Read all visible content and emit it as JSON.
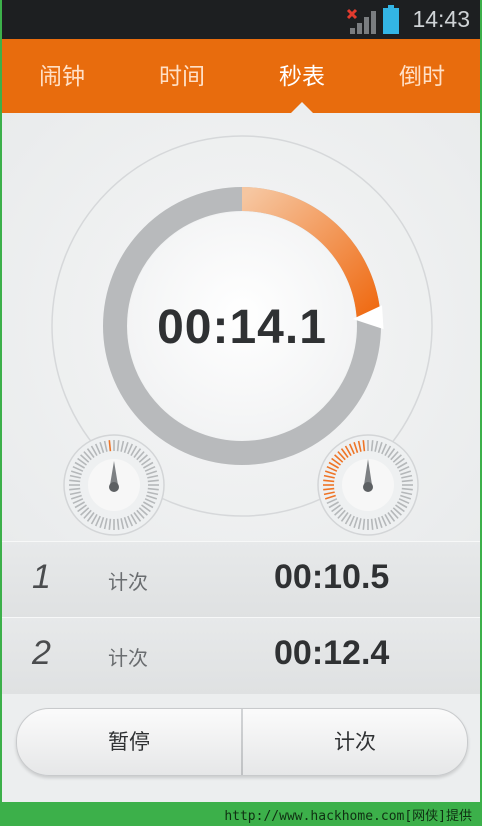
{
  "status_bar": {
    "time": "14:43"
  },
  "tabs": [
    {
      "label": "闹钟"
    },
    {
      "label": "时间"
    },
    {
      "label": "秒表",
      "active": true
    },
    {
      "label": "倒时"
    }
  ],
  "stopwatch": {
    "elapsed": "00:14.1",
    "progress_fraction": 0.24
  },
  "laps": [
    {
      "number": "1",
      "label": "计次",
      "time": "00:10.5"
    },
    {
      "number": "2",
      "label": "计次",
      "time": "00:12.4"
    }
  ],
  "buttons": {
    "pause_label": "暂停",
    "lap_label": "计次"
  },
  "footer": {
    "text": "http://www.hackhome.com[网侠]提供"
  },
  "colors": {
    "accent": "#e86c0d",
    "status_bar": "#1d1f21",
    "footer_bg": "#3cb04a"
  }
}
